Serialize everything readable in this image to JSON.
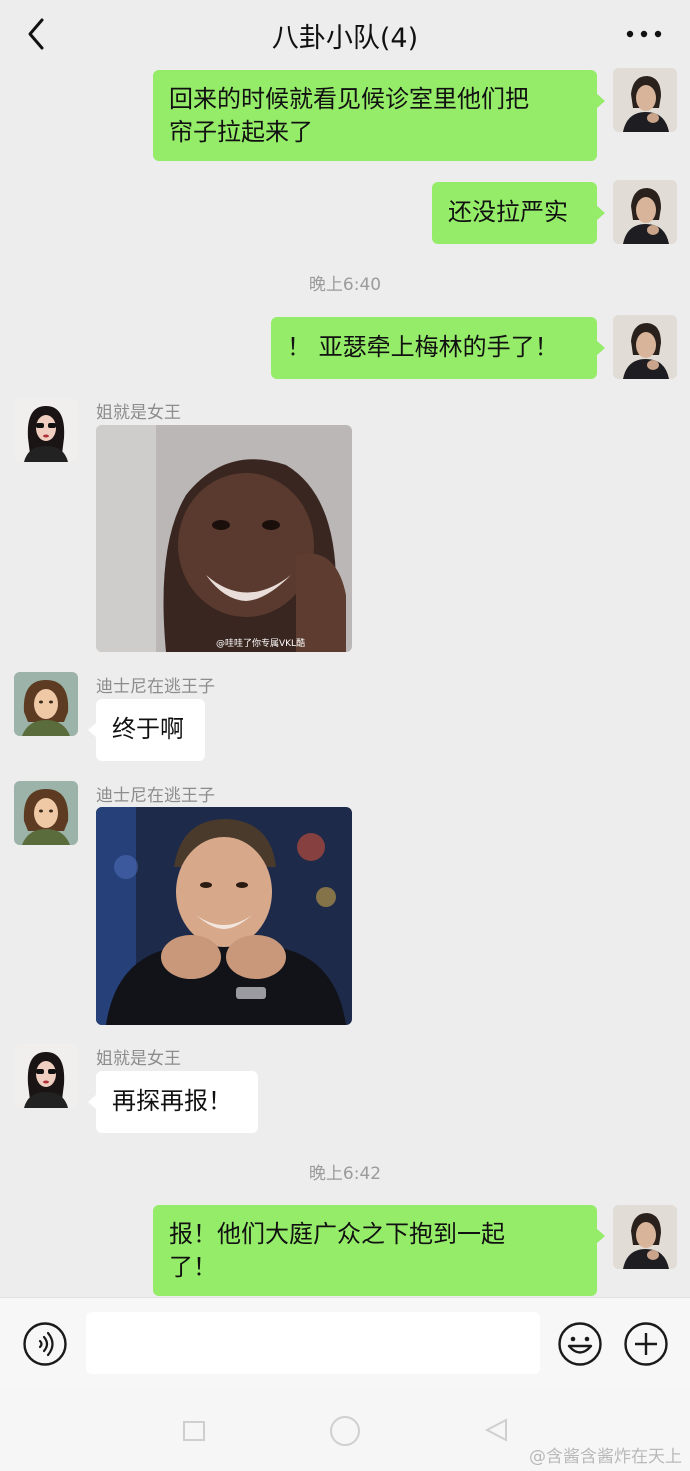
{
  "header": {
    "title": "八卦小队(4)"
  },
  "messages": {
    "m1": {
      "text_line1": "回来的时候就看见候诊室里他们把",
      "text_line2": "帘子拉起来了"
    },
    "m2": {
      "text": "还没拉严实"
    },
    "time1": "晚上6:40",
    "m3": {
      "text": "！ 亚瑟牵上梅林的手了！"
    },
    "m4": {
      "sender": "姐就是女王",
      "image_caption": "@哇哇了你专属VKL酷"
    },
    "m5": {
      "sender": "迪士尼在逃王子",
      "text": "终于啊"
    },
    "m6": {
      "sender": "迪士尼在逃王子"
    },
    "m7": {
      "sender": "姐就是女王",
      "text": "再探再报！"
    },
    "time2": "晚上6:42",
    "m8": {
      "text_line1": "报！他们大庭广众之下抱到一起",
      "text_line2": "了！"
    }
  },
  "input": {
    "placeholder": ""
  },
  "credit": "@含酱含酱炸在天上",
  "colors": {
    "my_bubble": "#95ec69",
    "other_bubble": "#ffffff",
    "background": "#ededed"
  },
  "icons": {
    "back": "chevron-left-icon",
    "more": "more-dots-icon",
    "voice": "voice-icon",
    "emoji": "emoji-icon",
    "plus": "plus-icon"
  }
}
